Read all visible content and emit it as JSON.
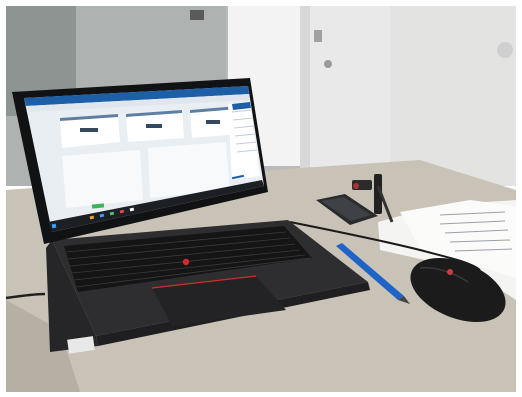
{
  "photo": {
    "laptop_screen": {
      "app_title": "",
      "kpi_values": [
        "",
        "",
        ""
      ]
    },
    "laptop_deck_label": ""
  },
  "colors": {
    "wall": "#b9bcbb",
    "door": "#ececec",
    "desk": "#c9c3b9",
    "laptop_body": "#2a2a2c",
    "screen_bezel": "#111214",
    "screen_bg": "#e9eef2",
    "accent_blue": "#1d5fa6",
    "trackpoint_red": "#d62a2a",
    "mouse": "#1a1a1a",
    "pen_blue": "#1f63c7"
  }
}
